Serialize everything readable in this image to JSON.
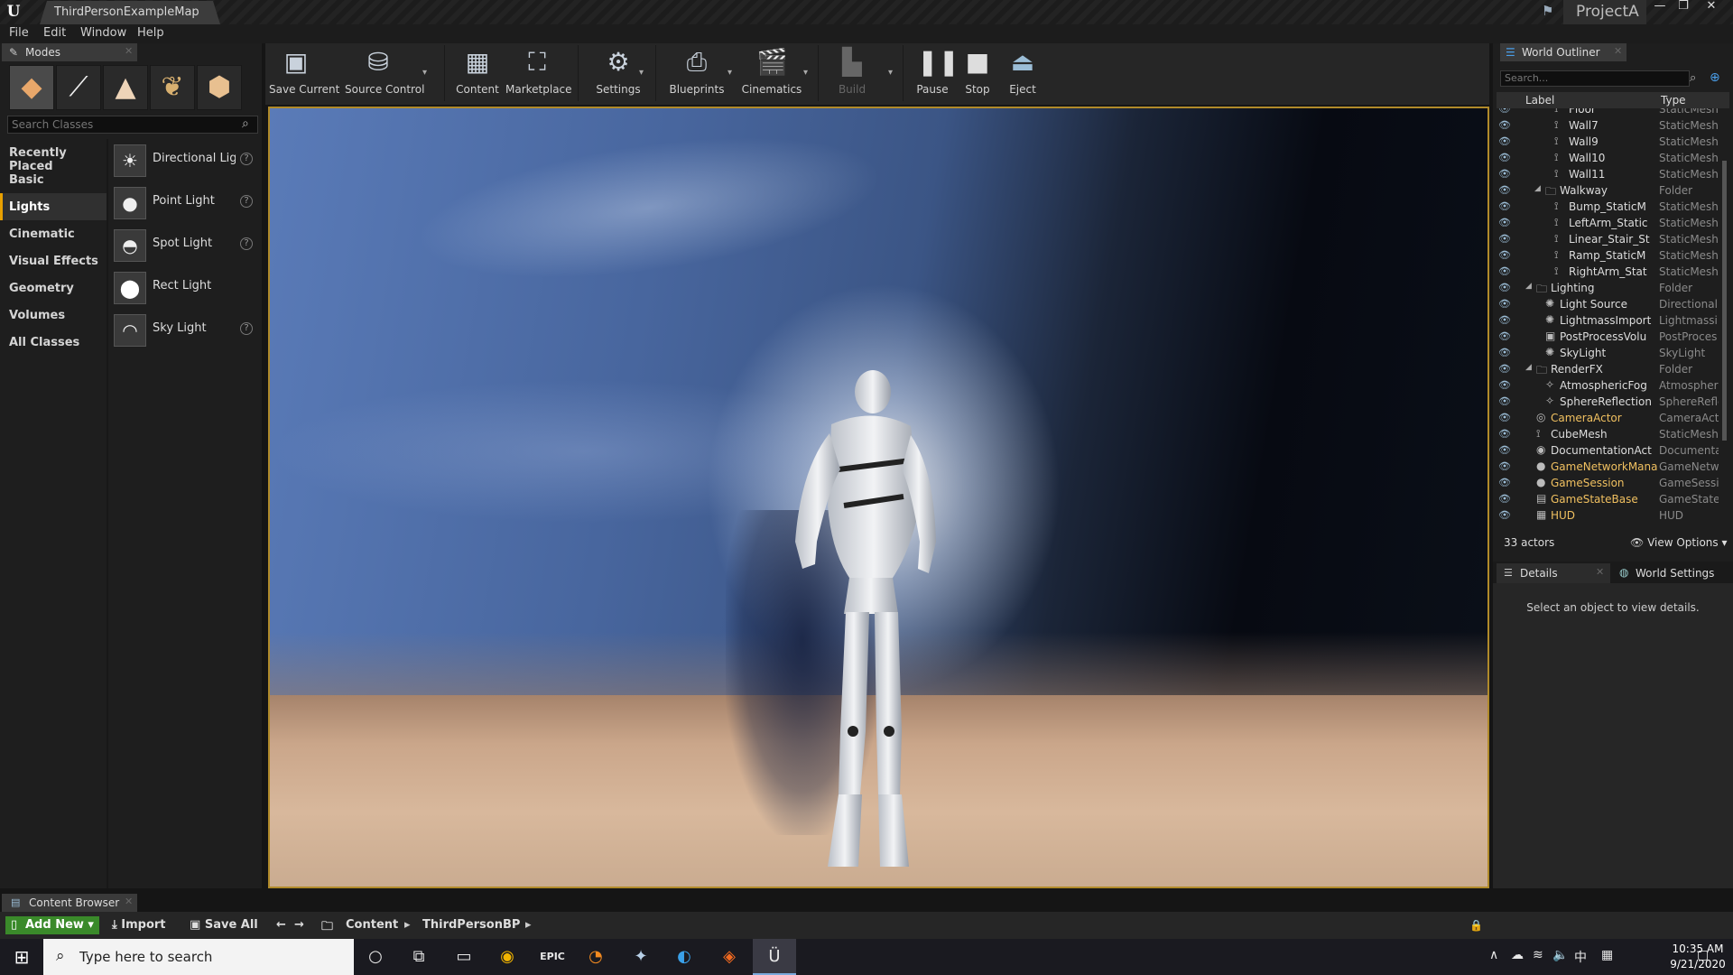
{
  "window": {
    "doc_tab": "ThirdPersonExampleMap",
    "project": "ProjectA"
  },
  "menu": [
    "File",
    "Edit",
    "Window",
    "Help"
  ],
  "modes": {
    "tab_label": "Modes",
    "search_placeholder": "Search Classes",
    "categories": [
      "Recently Placed",
      "Basic",
      "Lights",
      "Cinematic",
      "Visual Effects",
      "Geometry",
      "Volumes",
      "All Classes"
    ],
    "active_category": "Lights",
    "classes": [
      {
        "label": "Directional Light",
        "icon": "sun-icon"
      },
      {
        "label": "Point Light",
        "icon": "bulb-icon"
      },
      {
        "label": "Spot Light",
        "icon": "spotlight-icon"
      },
      {
        "label": "Rect Light",
        "icon": "sphere-icon"
      },
      {
        "label": "Sky Light",
        "icon": "dome-icon"
      }
    ]
  },
  "toolbar": {
    "save_current": "Save Current",
    "source_control": "Source Control",
    "content": "Content",
    "marketplace": "Marketplace",
    "settings": "Settings",
    "blueprints": "Blueprints",
    "cinematics": "Cinematics",
    "build": "Build",
    "pause": "Pause",
    "stop": "Stop",
    "eject": "Eject"
  },
  "outliner": {
    "tab_label": "World Outliner",
    "search_placeholder": "Search...",
    "col_label": "Label",
    "col_type": "Type",
    "rows": [
      {
        "label": "Floor",
        "type": "StaticMesh",
        "indent": 4,
        "kind": "mesh"
      },
      {
        "label": "Wall7",
        "type": "StaticMesh",
        "indent": 4,
        "kind": "mesh"
      },
      {
        "label": "Wall9",
        "type": "StaticMesh",
        "indent": 4,
        "kind": "mesh"
      },
      {
        "label": "Wall10",
        "type": "StaticMesh",
        "indent": 4,
        "kind": "mesh"
      },
      {
        "label": "Wall11",
        "type": "StaticMesh",
        "indent": 4,
        "kind": "mesh"
      },
      {
        "label": "Walkway",
        "type": "Folder",
        "indent": 3,
        "kind": "folder"
      },
      {
        "label": "Bump_StaticM",
        "type": "StaticMesh",
        "indent": 4,
        "kind": "mesh"
      },
      {
        "label": "LeftArm_Static",
        "type": "StaticMesh",
        "indent": 4,
        "kind": "mesh"
      },
      {
        "label": "Linear_Stair_St",
        "type": "StaticMesh",
        "indent": 4,
        "kind": "mesh"
      },
      {
        "label": "Ramp_StaticM",
        "type": "StaticMesh",
        "indent": 4,
        "kind": "mesh"
      },
      {
        "label": "RightArm_Stat",
        "type": "StaticMesh",
        "indent": 4,
        "kind": "mesh"
      },
      {
        "label": "Lighting",
        "type": "Folder",
        "indent": 2,
        "kind": "folder"
      },
      {
        "label": "Light Source",
        "type": "DirectionalL",
        "indent": 3,
        "kind": "light"
      },
      {
        "label": "LightmassImport",
        "type": "Lightmassi",
        "indent": 3,
        "kind": "light"
      },
      {
        "label": "PostProcessVolu",
        "type": "PostProces",
        "indent": 3,
        "kind": "volume"
      },
      {
        "label": "SkyLight",
        "type": "SkyLight",
        "indent": 3,
        "kind": "light"
      },
      {
        "label": "RenderFX",
        "type": "Folder",
        "indent": 2,
        "kind": "folder"
      },
      {
        "label": "AtmosphericFog",
        "type": "Atmospheri",
        "indent": 3,
        "kind": "fx"
      },
      {
        "label": "SphereReflection",
        "type": "SphereRefle",
        "indent": 3,
        "kind": "fx"
      },
      {
        "label": "CameraActor",
        "type": "CameraActo",
        "indent": 2,
        "kind": "camera",
        "highlight": true
      },
      {
        "label": "CubeMesh",
        "type": "StaticMesh",
        "indent": 2,
        "kind": "mesh"
      },
      {
        "label": "DocumentationAct",
        "type": "Documenta",
        "indent": 2,
        "kind": "doc"
      },
      {
        "label": "GameNetworkMana",
        "type": "GameNetwo",
        "indent": 2,
        "kind": "game",
        "highlight": true
      },
      {
        "label": "GameSession",
        "type": "GameSessio",
        "indent": 2,
        "kind": "game",
        "highlight": true
      },
      {
        "label": "GameStateBase",
        "type": "GameStateE",
        "indent": 2,
        "kind": "game2",
        "highlight": true
      },
      {
        "label": "HUD",
        "type": "HUD",
        "indent": 2,
        "kind": "hud",
        "highlight": true
      }
    ],
    "actor_count": "33 actors",
    "view_options": "View Options"
  },
  "details": {
    "tab_label": "Details",
    "world_settings_label": "World Settings",
    "empty_message": "Select an object to view details."
  },
  "content_browser": {
    "tab_label": "Content Browser",
    "add_new": "Add New",
    "import": "Import",
    "save_all": "Save All",
    "path": [
      "Content",
      "ThirdPersonBP"
    ]
  },
  "taskbar": {
    "search_placeholder": "Type here to search",
    "time": "10:35 AM",
    "date": "9/21/2020",
    "apps": [
      "cortana-icon",
      "task-view-icon",
      "file-explorer-icon",
      "chrome-icon",
      "epic-games-icon",
      "blender-icon",
      "app-icon",
      "edge-icon",
      "origin-icon",
      "unreal-editor-icon"
    ]
  },
  "colors": {
    "accent": "#e8a000",
    "viewport_border": "#b08a2a",
    "add_new_green": "#3a8a2a",
    "highlight_label": "#f0c060"
  }
}
